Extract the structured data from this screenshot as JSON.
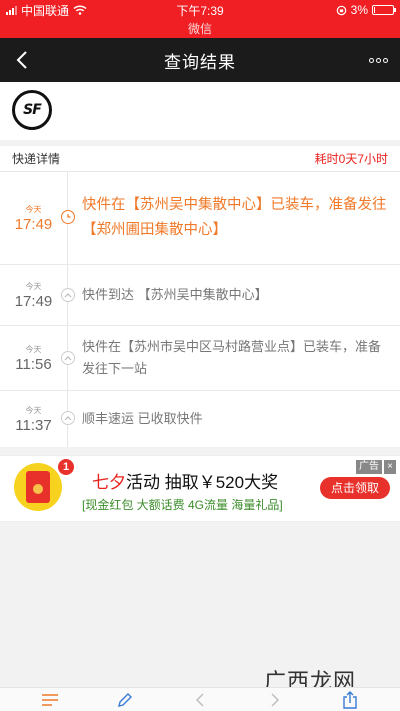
{
  "status_bar": {
    "carrier": "中国联通",
    "time": "下午7:39",
    "battery": "3%"
  },
  "wechat_label": "微信",
  "nav": {
    "title": "查询结果",
    "back_icon": "chevron-left-icon",
    "more_icon": "more-dots-icon"
  },
  "brand": {
    "logo_text": "SF"
  },
  "detail_header": {
    "label": "快递详情",
    "duration": "耗时0天7小时"
  },
  "timeline": [
    {
      "day": "今天",
      "time": "17:49",
      "text": "快件在【苏州吴中集散中心】已装车，准备发往 【郑州圃田集散中心】",
      "active": true
    },
    {
      "day": "今天",
      "time": "17:49",
      "text": "快件到达 【苏州吴中集散中心】",
      "active": false
    },
    {
      "day": "今天",
      "time": "11:56",
      "text": "快件在【苏州市吴中区马村路营业点】已装车，准备发往下一站",
      "active": false
    },
    {
      "day": "今天",
      "time": "11:37",
      "text": "顺丰速运 已收取快件",
      "active": false
    }
  ],
  "ad": {
    "badge": "1",
    "headline_highlight": "七夕",
    "headline_rest": "活动 抽取￥520大奖",
    "subline": "[现金红包  大额话费  4G流量  海量礼品]",
    "tag": "广告",
    "close": "×",
    "cta": "点击领取"
  },
  "toolbar": [
    "list-icon",
    "pencil-icon",
    "back-arrow-icon",
    "forward-arrow-icon",
    "share-icon"
  ],
  "watermark": "广西龙网",
  "colors": {
    "brand_red": "#ef1f24",
    "nav_dark": "#1b1b1b",
    "active_orange": "#f07a2a",
    "duration_red": "#e8211d"
  }
}
